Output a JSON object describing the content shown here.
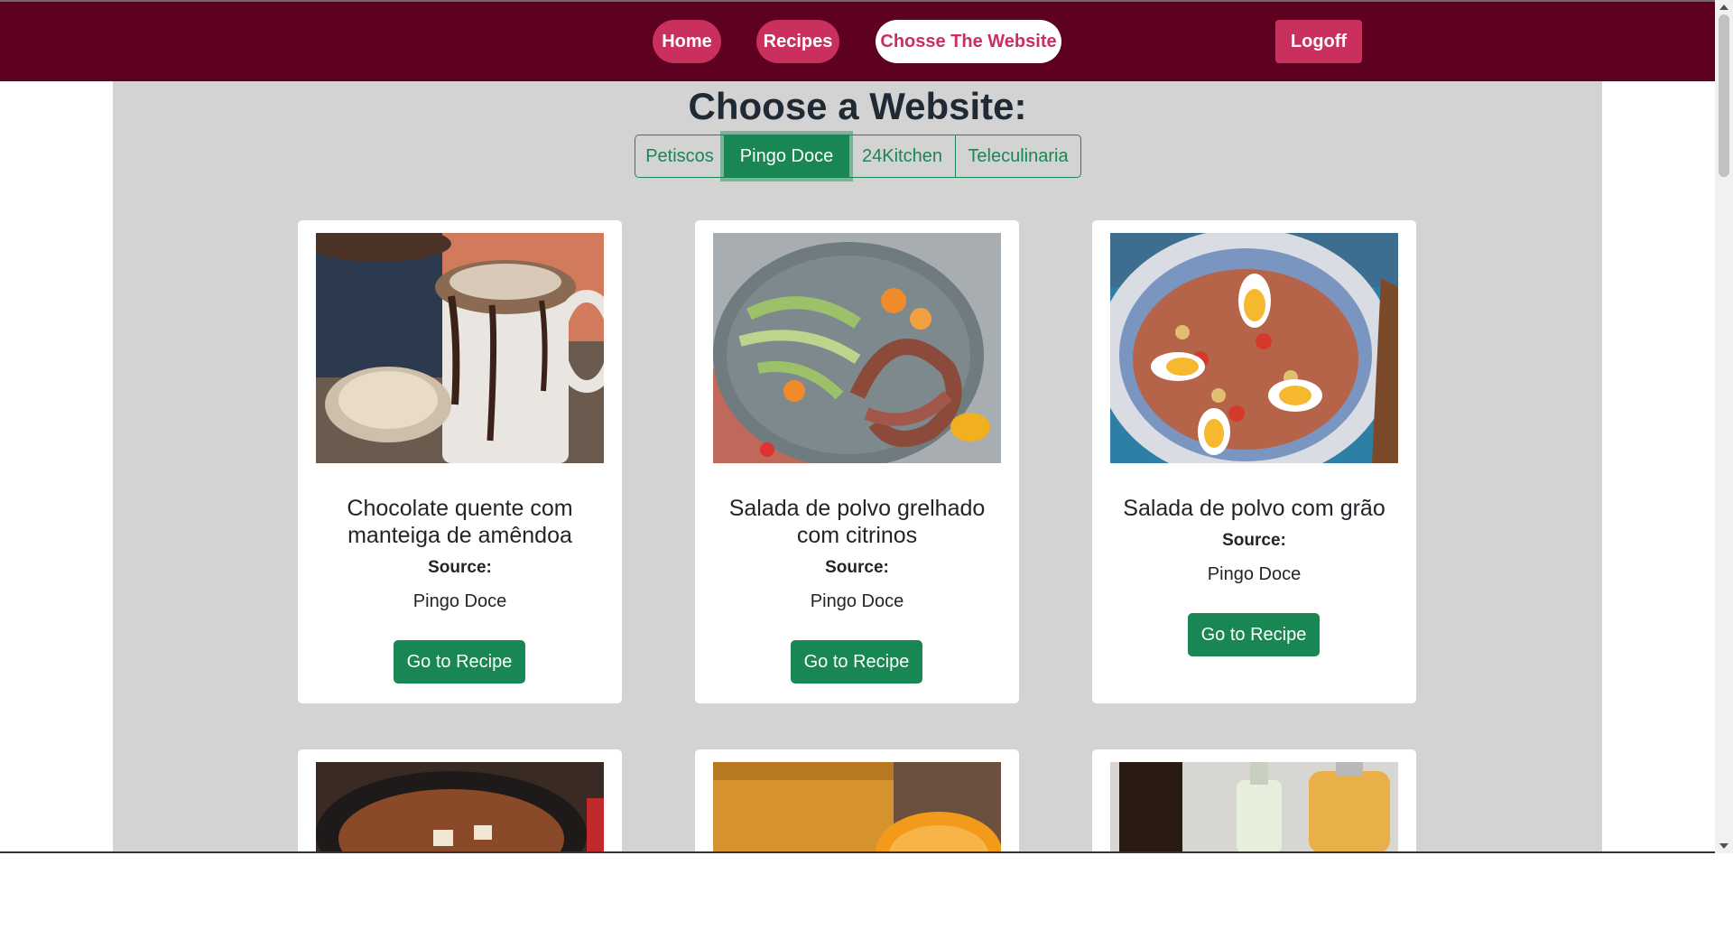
{
  "nav": {
    "home": "Home",
    "recipes": "Recipes",
    "choose_site": "Chosse The Website",
    "logoff": "Logoff"
  },
  "heading": "Choose a Website:",
  "sites": [
    "Petiscos",
    "Pingo Doce",
    "24Kitchen",
    "Teleculinaria"
  ],
  "selected_site": "Pingo Doce",
  "cards": [
    {
      "title_line1": "Chocolate quente com",
      "title_line2": "manteiga de amêndoa",
      "source_label": "Source:",
      "source": "Pingo Doce",
      "button": "Go to Recipe"
    },
    {
      "title_line1": "Salada de polvo grelhado",
      "title_line2": "com citrinos",
      "source_label": "Source:",
      "source": "Pingo Doce",
      "button": "Go to Recipe"
    },
    {
      "title_line1": "Salada de polvo com grão",
      "title_line2": "",
      "source_label": "Source:",
      "source": "Pingo Doce",
      "button": "Go to Recipe"
    }
  ],
  "colors": {
    "navbar": "#5e0020",
    "accent_pink": "#c9305d",
    "green": "#198754",
    "page_bg": "#d3d3d3"
  }
}
